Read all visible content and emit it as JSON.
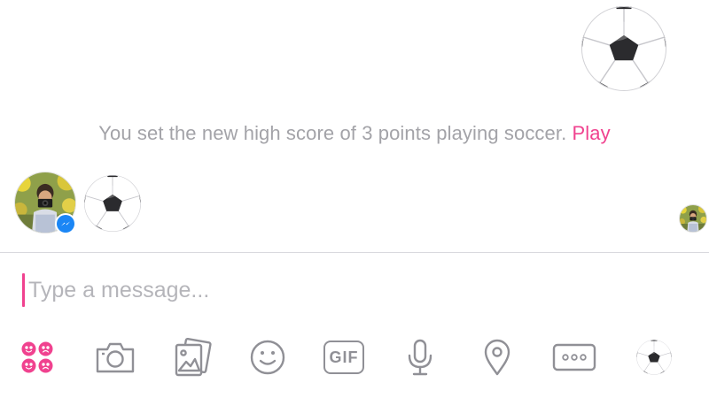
{
  "conversation": {
    "system_message": {
      "text": "You set the new high score of 3 points playing soccer.",
      "link_label": "Play"
    }
  },
  "composer": {
    "placeholder": "Type a message..."
  },
  "toolbar": {
    "items": [
      {
        "icon": "games-icon"
      },
      {
        "icon": "camera-icon"
      },
      {
        "icon": "gallery-icon"
      },
      {
        "icon": "emoji-icon"
      },
      {
        "icon": "gif-icon",
        "label": "GIF"
      },
      {
        "icon": "microphone-icon"
      },
      {
        "icon": "location-pin-icon"
      },
      {
        "icon": "more-icon"
      },
      {
        "icon": "soccer-ball-icon"
      }
    ]
  },
  "colors": {
    "accent": "#f0428f",
    "messenger_blue": "#1b86f5",
    "muted_text": "#a3a3a8",
    "icon_gray": "#909096",
    "divider": "#d9d9de"
  }
}
